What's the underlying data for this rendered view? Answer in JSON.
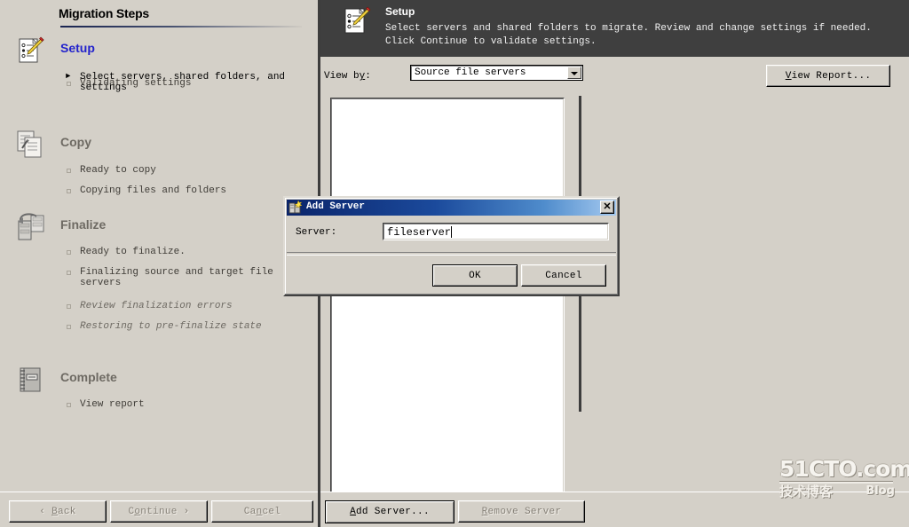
{
  "sidebar": {
    "title": "Migration Steps",
    "groups": [
      {
        "name": "Setup",
        "icon": "checklist-pencil-icon",
        "state": "active",
        "substeps": [
          {
            "label": "Select servers, shared folders, and settings",
            "marker": "arrow",
            "state": "cur"
          },
          {
            "label": "Validating settings",
            "marker": "box",
            "state": "done"
          }
        ]
      },
      {
        "name": "Copy",
        "icon": "copy-documents-icon",
        "state": "inactive",
        "substeps": [
          {
            "label": "Ready to copy",
            "marker": "box",
            "state": "done"
          },
          {
            "label": "Copying files and folders",
            "marker": "box",
            "state": "done"
          }
        ]
      },
      {
        "name": "Finalize",
        "icon": "servers-transfer-icon",
        "state": "inactive",
        "substeps": [
          {
            "label": "Ready to finalize.",
            "marker": "box",
            "state": "done"
          },
          {
            "label": "Finalizing source and target file servers",
            "marker": "box",
            "state": "done"
          },
          {
            "label": "Review finalization errors",
            "marker": "box",
            "state": "dim"
          },
          {
            "label": "Restoring to pre-finalize state",
            "marker": "box",
            "state": "dim"
          }
        ]
      },
      {
        "name": "Complete",
        "icon": "report-notebook-icon",
        "state": "inactive",
        "substeps": [
          {
            "label": "View report",
            "marker": "box",
            "state": "done"
          }
        ]
      }
    ]
  },
  "header": {
    "icon": "checklist-pencil-icon",
    "title": "Setup",
    "description": "Select servers and shared folders to migrate. Review and change settings if needed. Click Continue to validate settings."
  },
  "toolbar": {
    "view_by_label": "View by:",
    "view_by_accesskey": "y",
    "view_by_value": "Source file servers",
    "view_by_options": [
      "Source file servers"
    ],
    "view_report_label": "View Report...",
    "view_report_accesskey": "V"
  },
  "server_list": {
    "items": [],
    "empty": true
  },
  "bottom_bar": {
    "back_label": "Back",
    "back_accesskey": "B",
    "back_enabled": false,
    "continue_label": "Continue",
    "continue_accesskey": "o",
    "continue_enabled": false,
    "cancel_label": "Cancel",
    "cancel_accesskey": "n",
    "cancel_enabled": false,
    "add_server_label": "Add Server...",
    "add_server_accesskey": "A",
    "add_server_enabled": true,
    "remove_server_label": "Remove Server",
    "remove_server_accesskey": "R",
    "remove_server_enabled": false
  },
  "dialog": {
    "title": "Add Server",
    "title_icon": "add-server-icon",
    "close_label": "✕",
    "field_label": "Server:",
    "field_value": "fileserver",
    "ok_label": "OK",
    "cancel_label": "Cancel"
  },
  "watermark": {
    "main": "51CTO.com",
    "sub": "技术博客",
    "blog": "Blog"
  },
  "colors": {
    "face": "#d4d0c8",
    "header_bg": "#3f3f3f",
    "active_step": "#2222cc",
    "title_gradient_start": "#0a246a",
    "title_gradient_end": "#a6caf0"
  }
}
